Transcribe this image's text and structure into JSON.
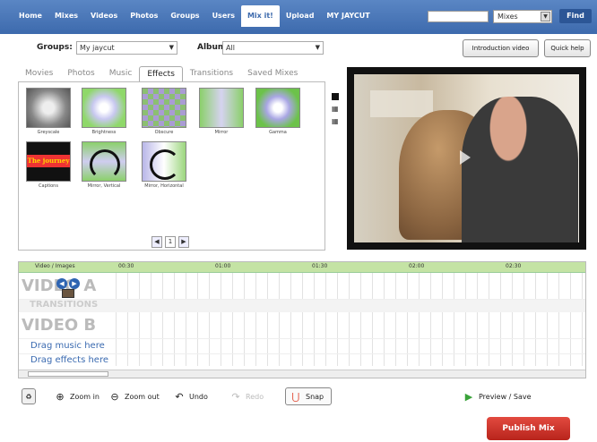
{
  "nav": {
    "items": [
      "Home",
      "Mixes",
      "Videos",
      "Photos",
      "Groups",
      "Users",
      "Mix it!",
      "Upload",
      "MY JAYCUT"
    ],
    "active_index": 6,
    "search_value": "",
    "scope_select": "Mixes",
    "find_label": "Find"
  },
  "groups_bar": {
    "groups_label": "Groups:",
    "groups_value": "My jaycut",
    "album_label": "Album:",
    "album_value": "All",
    "intro_button": "Introduction video",
    "help_button": "Quick help"
  },
  "tabs": [
    "Movies",
    "Photos",
    "Music",
    "Effects",
    "Transitions",
    "Saved Mixes"
  ],
  "active_tab": "Effects",
  "effects": [
    {
      "name": "Greyscale"
    },
    {
      "name": "Brightness"
    },
    {
      "name": "Obscure"
    },
    {
      "name": "Mirror"
    },
    {
      "name": "Gamma"
    },
    {
      "name": "Captions",
      "overlay": "The journey"
    },
    {
      "name": "Mirror, Vertical"
    },
    {
      "name": "Mirror, Horizontal"
    }
  ],
  "pager": {
    "current": "1"
  },
  "timeline": {
    "ruler_label": "Video / Images",
    "ticks": [
      "00:30",
      "01:00",
      "01:30",
      "02:00",
      "02:30"
    ],
    "rows": {
      "video_a": "VIDEO A",
      "transitions": "TRANSITIONS",
      "video_b": "VIDEO B",
      "music": "Drag music here",
      "effects": "Drag effects here"
    }
  },
  "toolbar": {
    "zoom_in": "Zoom in",
    "zoom_out": "Zoom out",
    "undo": "Undo",
    "redo": "Redo",
    "snap": "Snap",
    "preview_save": "Preview / Save"
  },
  "publish_label": "Publish Mix",
  "colors": {
    "nav_blue": "#3d6aad",
    "ruler_green": "#c4e3a4",
    "publish_red": "#c9322a",
    "link_blue": "#3a6ab0"
  }
}
